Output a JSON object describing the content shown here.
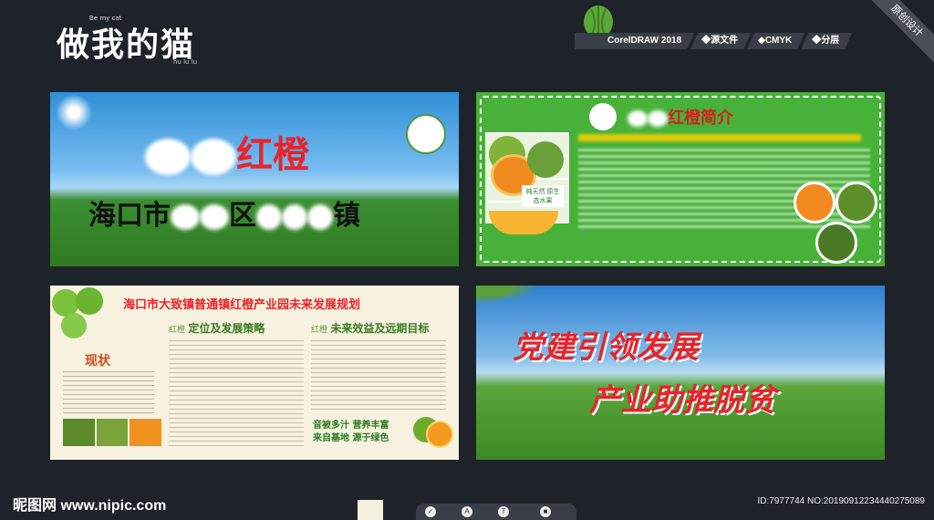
{
  "header": {
    "logo_small": "Be my cat",
    "logo_main": "做我的猫",
    "logo_sub": "hu lu lu",
    "toolbar": [
      "CorelDRAW 2018",
      "◆源文件",
      "◆CMYK",
      "◆分层"
    ],
    "corner_label": "原创设计"
  },
  "panel1": {
    "title_suffix": "红橙",
    "address_parts": [
      "海口市",
      "区",
      "镇"
    ]
  },
  "panel2": {
    "title_suffix": "红橙简介",
    "badge": "纯天然 原生态水果"
  },
  "panel3": {
    "title": "海口市大致镇普通镇红橙产业园未来发展规划",
    "section_status": "现状",
    "section_mid_tag": "红橙",
    "section_mid_title": "定位及发展策略",
    "section_right_tag": "红橙",
    "section_right_title": "未来效益及远期目标",
    "slogan_1": "音被多汁 营养丰富",
    "slogan_2": "来自基地 源于绿色"
  },
  "panel4": {
    "line1": "党建引领发展",
    "line2": "产业助推脱贫"
  },
  "footer": {
    "site": "昵图网 www.nipic.com",
    "id_text": "ID:7977744 NO:20190912234440275089"
  },
  "colors": {
    "title_red": "#e8242a",
    "green": "#47b13a",
    "background": "#1e2229"
  }
}
